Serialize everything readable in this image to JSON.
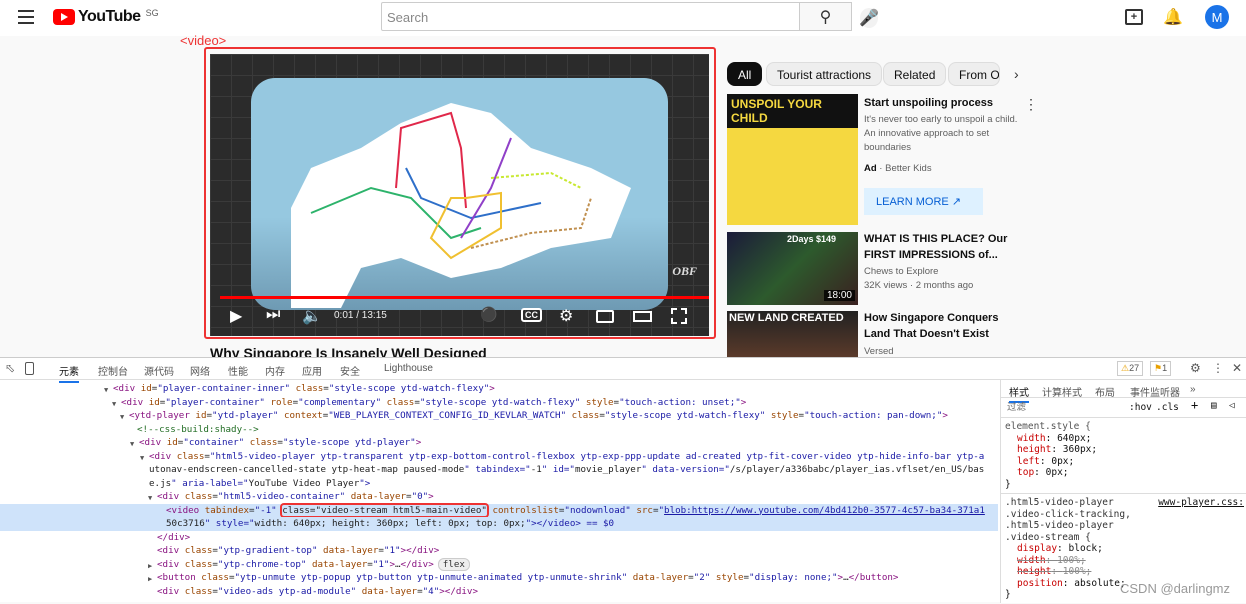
{
  "header": {
    "logo_text": "YouTube",
    "region": "SG",
    "search_placeholder": "Search",
    "avatar_letter": "M"
  },
  "player": {
    "overlay_label": "<video>",
    "watermark": "OBF",
    "time": "0:01 / 13:15",
    "progress_percent": 0.13,
    "video_title": "Why Singapore Is Insanely Well Designed"
  },
  "chips": [
    "All",
    "Tourist attractions",
    "Related",
    "From OB"
  ],
  "recommendations": [
    {
      "thumb_text": "UNSPOIL YOUR CHILD",
      "title": "Start unspoiling process",
      "description": "It's never too early to unspoil a child. An innovative approach to set boundaries",
      "ad_label": "Ad",
      "channel": "Better Kids",
      "cta": "LEARN MORE"
    },
    {
      "thumb_text": "2Days $149",
      "duration": "18:00",
      "title": "WHAT IS THIS PLACE? Our FIRST IMPRESSIONS of...",
      "channel": "Chews to Explore",
      "meta": "32K views · 2 months ago"
    },
    {
      "thumb_text": "NEW LAND CREATED",
      "title": "How Singapore Conquers Land That Doesn't Exist",
      "channel": "Versed"
    }
  ],
  "devtools": {
    "tabs": [
      "元素",
      "控制台",
      "源代码",
      "网络",
      "性能",
      "内存",
      "应用",
      "安全",
      "Lighthouse"
    ],
    "warnings": "27",
    "issues": "1",
    "dom_lines": [
      "<div id=\"player-container-inner\" class=\"style-scope ytd-watch-flexy\">",
      "<div id=\"player-container\" role=\"complementary\" class=\"style-scope ytd-watch-flexy\" style=\"touch-action: unset;\">",
      "<ytd-player id=\"ytd-player\" context=\"WEB_PLAYER_CONTEXT_CONFIG_ID_KEVLAR_WATCH\" class=\"style-scope ytd-watch-flexy\" style=\"touch-action: pan-down;\">",
      "<!--css-build:shady-->",
      "<div id=\"container\" class=\"style-scope ytd-player\">",
      "<div class=\"html5-video-player ytp-transparent ytp-exp-bottom-control-flexbox ytp-exp-ppp-update ad-created ytp-fit-cover-video ytp-hide-info-bar ytp-a",
      "utonav-endscreen-cancelled-state ytp-heat-map paused-mode\" tabindex=\"-1\" id=\"movie_player\" data-version=\"/s/player/a336babc/player_ias.vflset/en_US/bas",
      "e.js\" aria-label=\"YouTube Video Player\">",
      "<div class=\"html5-video-container\" data-layer=\"0\">",
      "<video tabindex=\"-1\" ",
      "50c3716\" style=\"width: 640px; height: 360px; left: 0px; top: 0px;\"></video> == $0",
      "</div>",
      "<div class=\"ytp-gradient-top\" data-layer=\"1\"></div>",
      "<div class=\"ytp-chrome-top\" data-layer=\"1\">…</div>",
      "<button class=\"ytp-unmute ytp-popup ytp-button ytp-unmute-animated ytp-unmute-shrink\" data-layer=\"2\" style=\"display: none;\">…</button>",
      "<div class=\"video-ads ytp-ad-module\" data-layer=\"4\"></div>"
    ],
    "selected_highlight": "class=\"video-stream html5-main-video\"",
    "selected_rest": " controlslist=\"nodownload\" src=\"",
    "selected_link": "blob:https://www.youtube.com/4bd412b0-3577-4c57-ba34-371a1",
    "flex_badge": "flex",
    "styles_tabs": [
      "样式",
      "计算样式",
      "布局",
      "事件监听器",
      "»"
    ],
    "filter_placeholder": "过滤",
    "hov": ":hov",
    ".cls": ".cls",
    "rule1": {
      "selector": "element.style {",
      "props": [
        [
          "width",
          "640px"
        ],
        [
          "height",
          "360px"
        ],
        [
          "left",
          "0px"
        ],
        [
          "top",
          "0px"
        ]
      ]
    },
    "rule2": {
      "selector": ".html5-video-player .video-click-tracking, .html5-video-player .video-stream {",
      "source": "www-player.css:",
      "props": [
        [
          "display",
          "block",
          false
        ],
        [
          "width",
          "100%",
          true
        ],
        [
          "height",
          "100%",
          true
        ],
        [
          "position",
          "absolute",
          false
        ]
      ]
    }
  },
  "watermark": "CSDN @darlingmz"
}
